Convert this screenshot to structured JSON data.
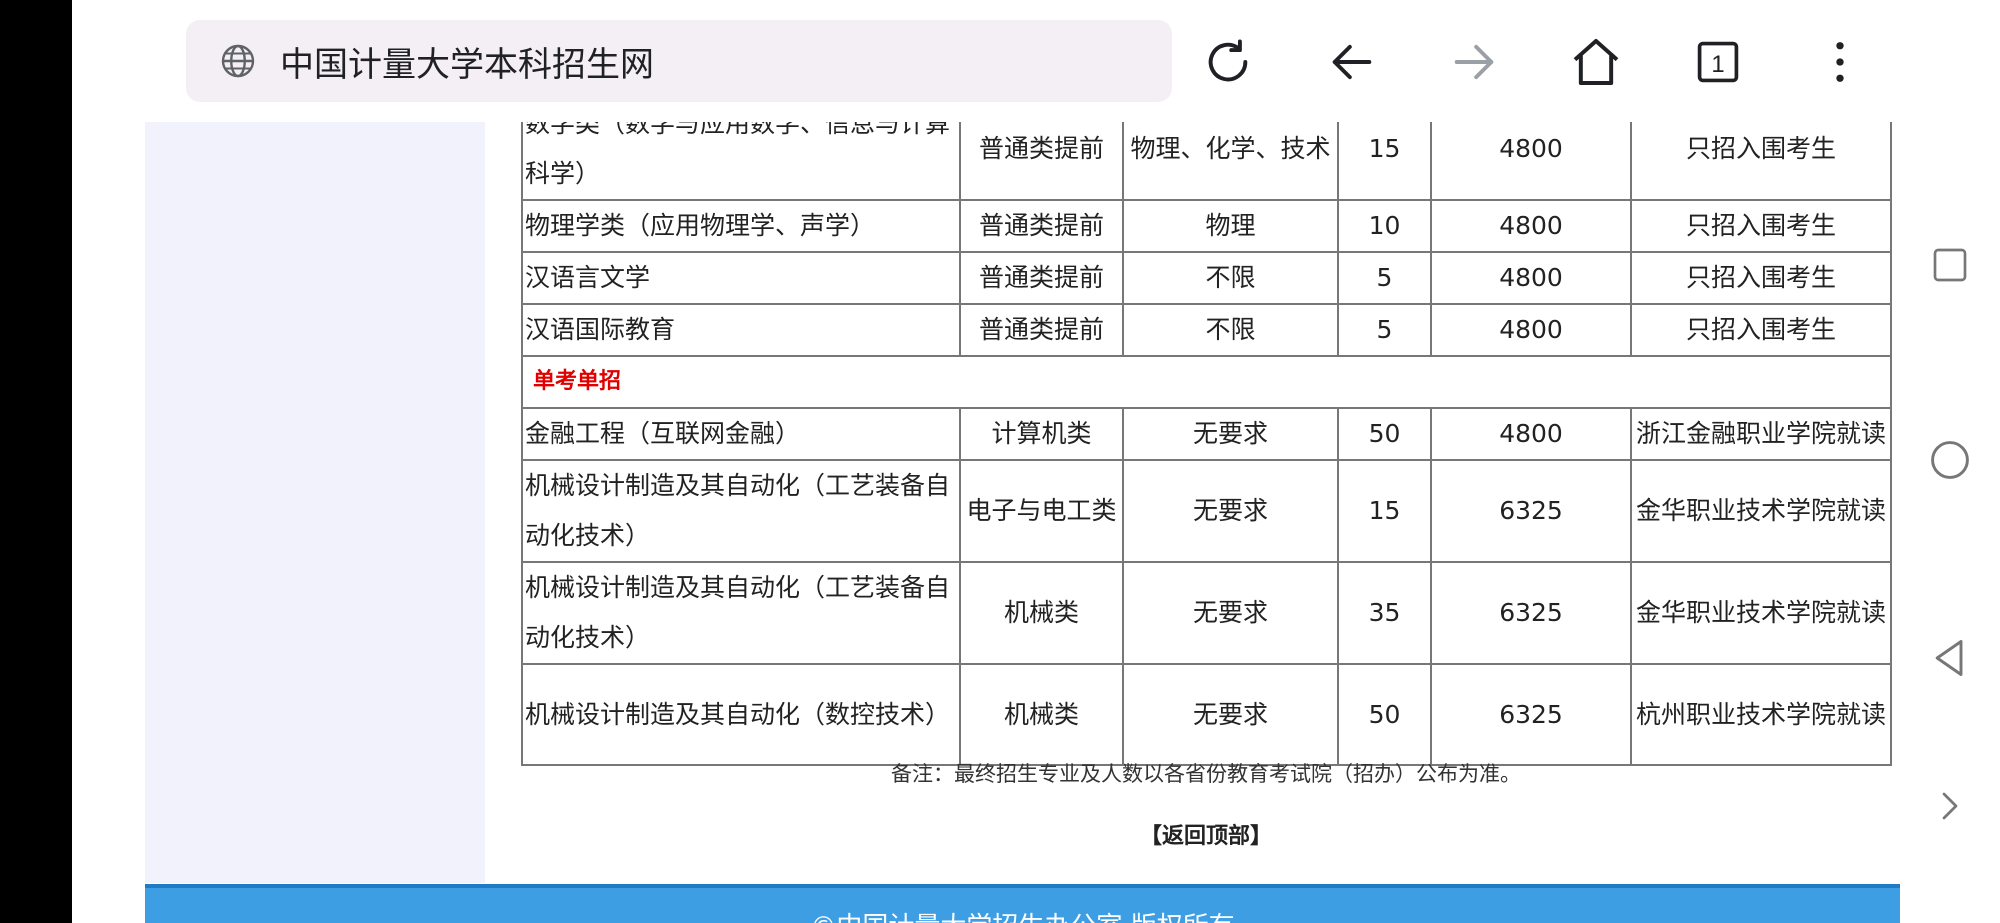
{
  "browser": {
    "url_text": "中国计量大学本科招生网",
    "tab_count": "1"
  },
  "table": {
    "rows": [
      {
        "major": "数学类（数学与应用数学、信息与计算科学）",
        "type": "普通类提前",
        "subject": "物理、化学、技术",
        "count": "15",
        "fee": "4800",
        "note": "只招入围考生",
        "tall": true
      },
      {
        "major": "物理学类（应用物理学、声学）",
        "type": "普通类提前",
        "subject": "物理",
        "count": "10",
        "fee": "4800",
        "note": "只招入围考生"
      },
      {
        "major": "汉语言文学",
        "type": "普通类提前",
        "subject": "不限",
        "count": "5",
        "fee": "4800",
        "note": "只招入围考生"
      },
      {
        "major": "汉语国际教育",
        "type": "普通类提前",
        "subject": "不限",
        "count": "5",
        "fee": "4800",
        "note": "只招入围考生"
      }
    ],
    "section_label": "单考单招",
    "rows2": [
      {
        "major": "金融工程（互联网金融）",
        "type": "计算机类",
        "subject": "无要求",
        "count": "50",
        "fee": "4800",
        "note": "浙江金融职业学院就读"
      },
      {
        "major": "机械设计制造及其自动化（工艺装备自动化技术）",
        "type": "电子与电工类",
        "subject": "无要求",
        "count": "15",
        "fee": "6325",
        "note": "金华职业技术学院就读",
        "tall": true
      },
      {
        "major": "机械设计制造及其自动化（工艺装备自动化技术）",
        "type": "机械类",
        "subject": "无要求",
        "count": "35",
        "fee": "6325",
        "note": "金华职业技术学院就读",
        "tall": true
      },
      {
        "major": "机械设计制造及其自动化（数控技术）",
        "type": "机械类",
        "subject": "无要求",
        "count": "50",
        "fee": "6325",
        "note": "杭州职业技术学院就读",
        "tall": true
      }
    ]
  },
  "note_text": "备注：最终招生专业及人数以各省份教育考试院（招办）公布为准。",
  "back_to_top": "【返回顶部】",
  "footer_text": "©中国计量大学招生办公室 版权所有",
  "colors": {
    "section_red": "#e00000",
    "footer_blue": "#3d9ee3",
    "sidebar_bg": "#f1f2fb"
  }
}
